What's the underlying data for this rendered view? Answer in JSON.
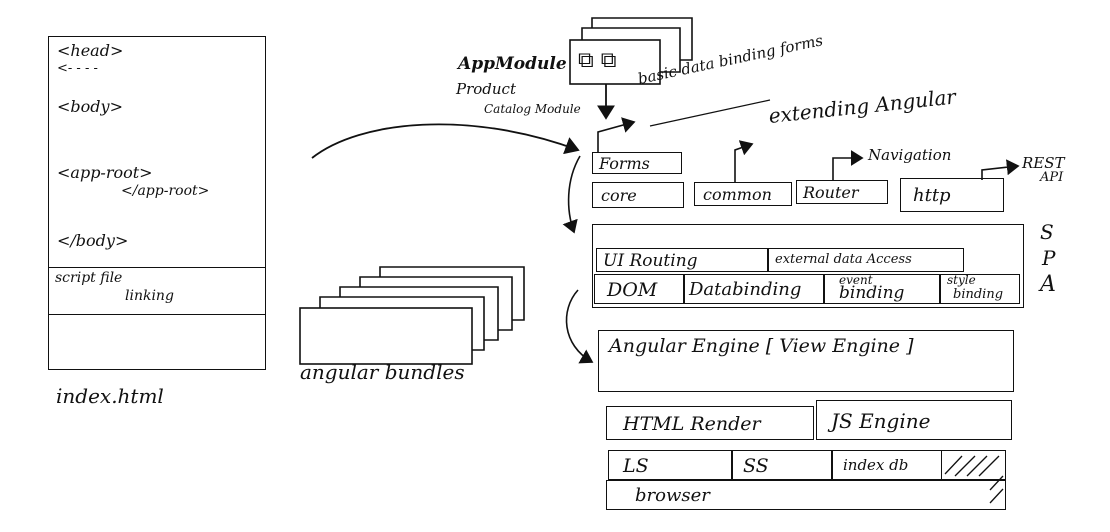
{
  "index_html": {
    "head_tag": "<head>",
    "head_dots": "<- - - -",
    "body_tag": "<body>",
    "app_root_open": "<app-root>",
    "app_root_close": "</app-root>",
    "body_close": "</body>",
    "script_line1": "script file",
    "script_line2": "linking",
    "caption": "index.html"
  },
  "bundles": {
    "caption": "angular bundles"
  },
  "app_module": {
    "title": "AppModule",
    "sub1": "Product",
    "sub2": "Catalog Module",
    "basic_data_binding": "basic data binding forms"
  },
  "extending": {
    "title": "extending Angular"
  },
  "modules_row1": {
    "forms": "Forms"
  },
  "modules_row2": {
    "core": "core",
    "common": "common",
    "router": "Router",
    "http": "http",
    "navigation": "Navigation",
    "rest_api_line1": "REST",
    "rest_api_line2": "API"
  },
  "spa": {
    "letters": [
      "S",
      "P",
      "A"
    ],
    "ui_routing": "UI Routing",
    "external_data_access": "external data Access",
    "dom": "DOM",
    "databinding": "Databinding",
    "event_binding_1": "event",
    "event_binding_2": "binding",
    "style_binding_1": "style",
    "style_binding_2": "binding"
  },
  "engine": {
    "label": "Angular Engine [ View Engine ]"
  },
  "browser_layer": {
    "html_render": "HTML Render",
    "js_engine": "JS Engine",
    "ls": "LS",
    "ss": "SS",
    "indexdb": "index db",
    "browser": "browser"
  }
}
